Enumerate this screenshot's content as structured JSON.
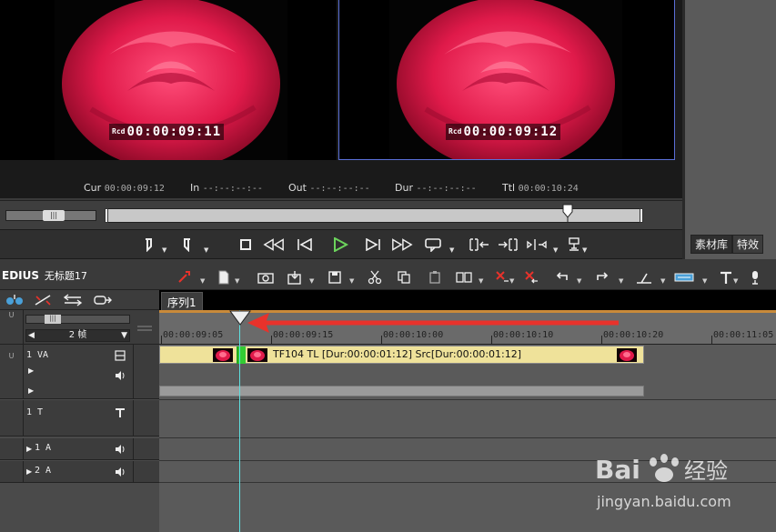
{
  "player_monitor": {
    "tc_prefix": "Rcd",
    "timecode": "00:00:09:11"
  },
  "recorder_monitor": {
    "tc_prefix": "Rcd",
    "timecode": "00:00:09:12"
  },
  "timecode_bar": {
    "cur_label": "Cur",
    "cur_value": "00:00:09:12",
    "in_label": "In",
    "in_value": "--:--:--:--",
    "out_label": "Out",
    "out_value": "--:--:--:--",
    "dur_label": "Dur",
    "dur_value": "--:--:--:--",
    "ttl_label": "Ttl",
    "ttl_value": "00:00:10:24"
  },
  "right_panel": {
    "tabs": [
      "素材库",
      "特效"
    ]
  },
  "project": {
    "brand": "EDIUS",
    "name": "无标题17"
  },
  "timeline": {
    "sequence_tab": "序列1",
    "frame_unit": "2 帧",
    "ruler_ticks": [
      "00:00:09:05",
      "00:00:09:15",
      "00:00:10:00",
      "00:00:10:10",
      "00:00:10:20",
      "00:00:11:05"
    ],
    "tracks": [
      {
        "name": "1 VA",
        "type": "video-audio"
      },
      {
        "name": "1 T",
        "type": "title"
      },
      {
        "name": "1 A",
        "type": "audio"
      },
      {
        "name": "2 A",
        "type": "audio"
      }
    ],
    "clip_label": "TF104   TL [Dur:00:00:01:12]   Src[Dur:00:00:01:12]"
  },
  "watermark": {
    "text": "jingyan.baidu.com",
    "logo_text": "Bai du 经验"
  },
  "colors": {
    "accent_playhead": "#5fe0e0",
    "clip_fill": "#efe29a",
    "annotation_arrow": "#e8322b",
    "play_green": "#6cd35c"
  }
}
